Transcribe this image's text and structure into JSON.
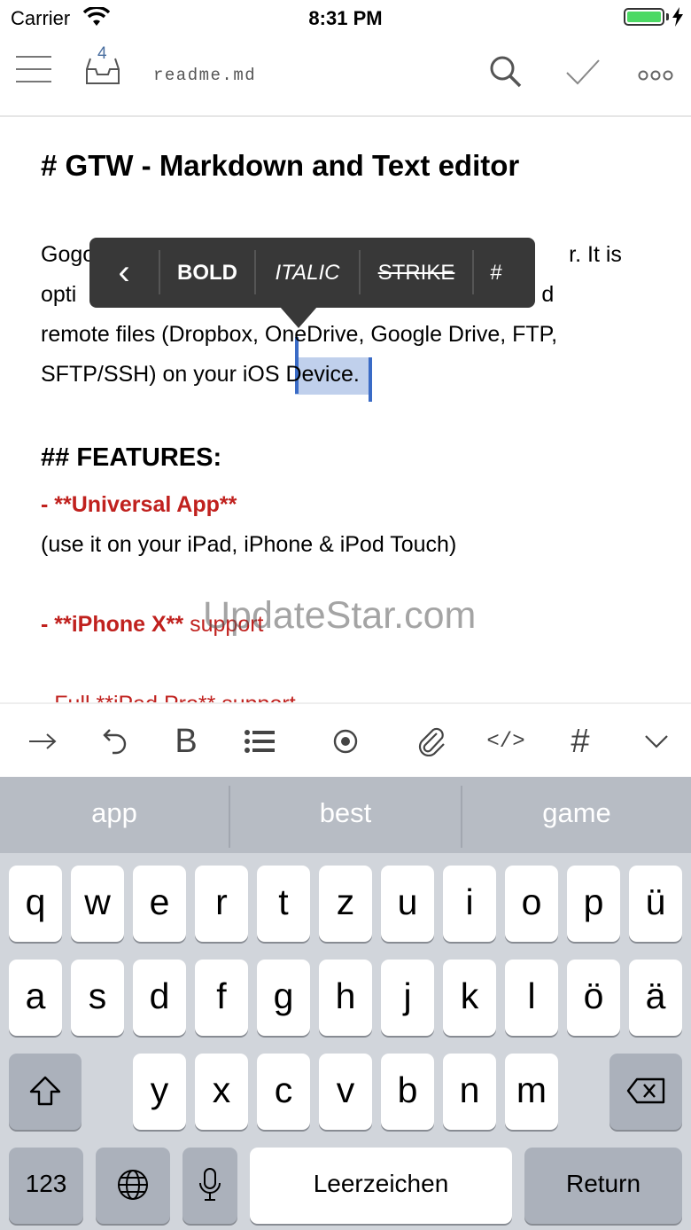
{
  "status_bar": {
    "carrier": "Carrier",
    "time": "8:31 PM"
  },
  "toolbar": {
    "inbox_count": "4",
    "doc_name": "readme.md"
  },
  "document": {
    "heading": "# GTW - Markdown and Text editor",
    "para_line1_start": "Gogo",
    "para_line1_end": "r. It is",
    "para_line2_start": "opti",
    "para_line2_end": "d",
    "para_line3": "remote files (Dropbox, OneDrive, Google Drive, FTP,",
    "para_line4_start": "SFTP/SSH) on your iOS ",
    "para_line4_selected": "Device",
    "para_line4_end": ".",
    "features_heading": "## FEATURES:",
    "feature1": "- **Universal App**",
    "feature1_desc": "(use it on your iPad, iPhone & iPod Touch)",
    "feature2_bold": "- **iPhone X**",
    "feature2_rest": " support",
    "feature3_partial": "- Full **iPad Pro** support"
  },
  "popup_menu": {
    "back": "‹",
    "bold": "BOLD",
    "italic": "ITALIC",
    "strike": "STRIKE",
    "hash": "#"
  },
  "watermark": "UpdateStar.com",
  "format_bar": {
    "icons": [
      "indent-arrow-icon",
      "undo-icon",
      "bold-icon",
      "list-icon",
      "record-icon",
      "attachment-icon",
      "code-icon",
      "hash-icon",
      "chevron-down-icon"
    ],
    "bold_glyph": "B",
    "code_glyph": "</>",
    "hash_glyph": "#"
  },
  "keyboard": {
    "suggestions": [
      "app",
      "best",
      "game"
    ],
    "row1": [
      "q",
      "w",
      "e",
      "r",
      "t",
      "z",
      "u",
      "i",
      "o",
      "p",
      "ü"
    ],
    "row2": [
      "a",
      "s",
      "d",
      "f",
      "g",
      "h",
      "j",
      "k",
      "l",
      "ö",
      "ä"
    ],
    "row3": [
      "y",
      "x",
      "c",
      "v",
      "b",
      "n",
      "m"
    ],
    "numbers_key": "123",
    "space_key": "Leerzeichen",
    "return_key": "Return"
  },
  "colors": {
    "accent_red": "#c0211e",
    "selection_blue": "#3a6bc6",
    "battery_green": "#4cd964"
  }
}
